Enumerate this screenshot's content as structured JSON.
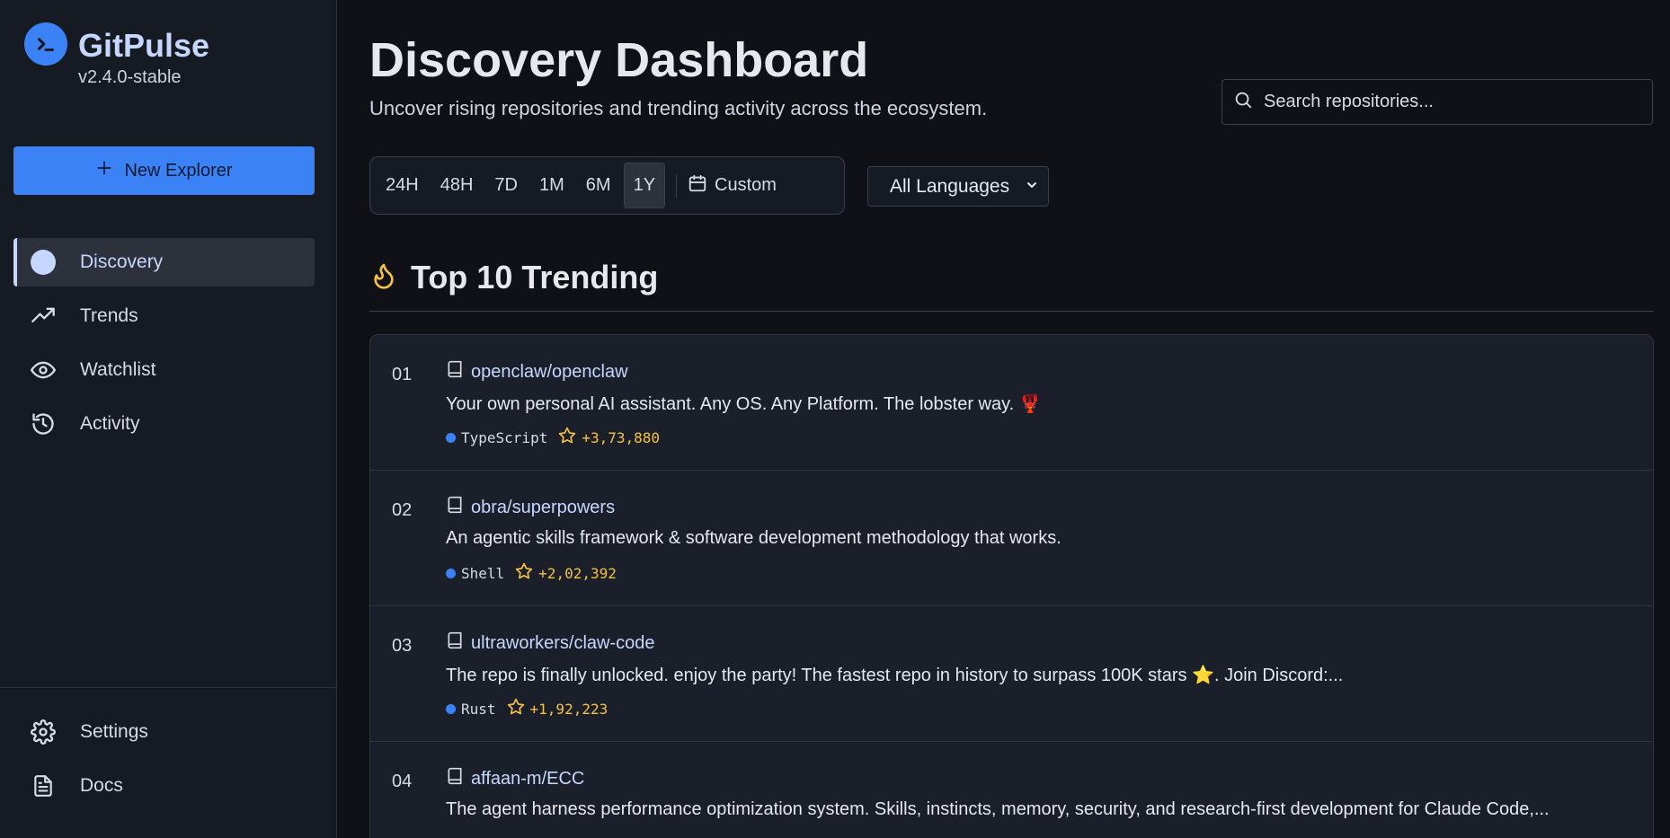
{
  "brand": {
    "name": "GitPulse",
    "version": "v2.4.0-stable"
  },
  "sidebar": {
    "new_button": "New Explorer",
    "items": [
      {
        "label": "Discovery",
        "icon": "dot-icon",
        "active": true
      },
      {
        "label": "Trends",
        "icon": "trending-up-icon",
        "active": false
      },
      {
        "label": "Watchlist",
        "icon": "eye-icon",
        "active": false
      },
      {
        "label": "Activity",
        "icon": "history-icon",
        "active": false
      }
    ],
    "footer": [
      {
        "label": "Settings",
        "icon": "gear-icon"
      },
      {
        "label": "Docs",
        "icon": "document-icon"
      }
    ]
  },
  "header": {
    "title": "Discovery Dashboard",
    "subtitle": "Uncover rising repositories and trending activity across the ecosystem.",
    "search_placeholder": "Search repositories..."
  },
  "filters": {
    "ranges": [
      "24H",
      "48H",
      "7D",
      "1M",
      "6M",
      "1Y"
    ],
    "active_range": "1Y",
    "custom_label": "Custom",
    "language_select": "All Languages"
  },
  "section": {
    "title": "Top 10 Trending"
  },
  "repos": [
    {
      "rank": "01",
      "name": "openclaw/openclaw",
      "description": "Your own personal AI assistant. Any OS. Any Platform. The lobster way. 🦞",
      "language": "TypeScript",
      "stars": "+3,73,880"
    },
    {
      "rank": "02",
      "name": "obra/superpowers",
      "description": "An agentic skills framework & software development methodology that works.",
      "language": "Shell",
      "stars": "+2,02,392"
    },
    {
      "rank": "03",
      "name": "ultraworkers/claw-code",
      "description": "The repo is finally unlocked. enjoy the party! The fastest repo in history to surpass 100K stars ⭐. Join Discord:...",
      "language": "Rust",
      "stars": "+1,92,223"
    },
    {
      "rank": "04",
      "name": "affaan-m/ECC",
      "description": "The agent harness performance optimization system. Skills, instincts, memory, security, and research-first development for Claude Code,...",
      "language": "",
      "stars": ""
    }
  ],
  "colors": {
    "accent": "#3b82f6",
    "link": "#c6d7ff",
    "star": "#f5c242",
    "background": "#0f1117"
  }
}
